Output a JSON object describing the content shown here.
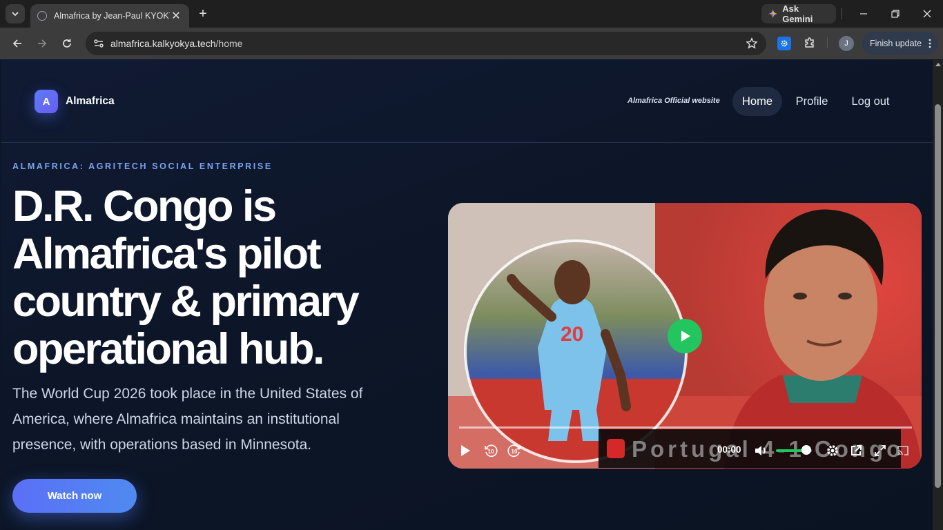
{
  "browser": {
    "tab_title": "Almafrica by Jean-Paul KYOKYA",
    "gemini_label": "Ask Gemini",
    "url_host": "almafrica.kalkyokya.tech",
    "url_path": "/home",
    "avatar_initial": "J",
    "finish_update_label": "Finish update"
  },
  "site": {
    "logo_letter": "A",
    "brand": "Almafrica",
    "official_label": "Almafrica Official website",
    "nav": {
      "home": "Home",
      "profile": "Profile",
      "logout": "Log out"
    }
  },
  "hero": {
    "eyebrow": "ALMAFRICA: AGRITECH SOCIAL ENTERPRISE",
    "headline": "D.R. Congo is Almafrica's pilot country & primary operational hub.",
    "lead": "The World Cup 2026 took place in the United States of America, where Almafrica maintains an institutional presence, with operations based in Minnesota.",
    "cta": "Watch now"
  },
  "video": {
    "banner_text": "Portugal 4-1 Congo",
    "current_time": "00:00",
    "volume_fraction": 0.85,
    "jersey_number": "20",
    "skip_back_seconds": "10",
    "skip_forward_seconds": "10"
  },
  "colors": {
    "accent": "#5b6ff7",
    "play_green": "#22c55e",
    "eyebrow": "#7ba3f0",
    "page_bg": "#0d1628"
  }
}
